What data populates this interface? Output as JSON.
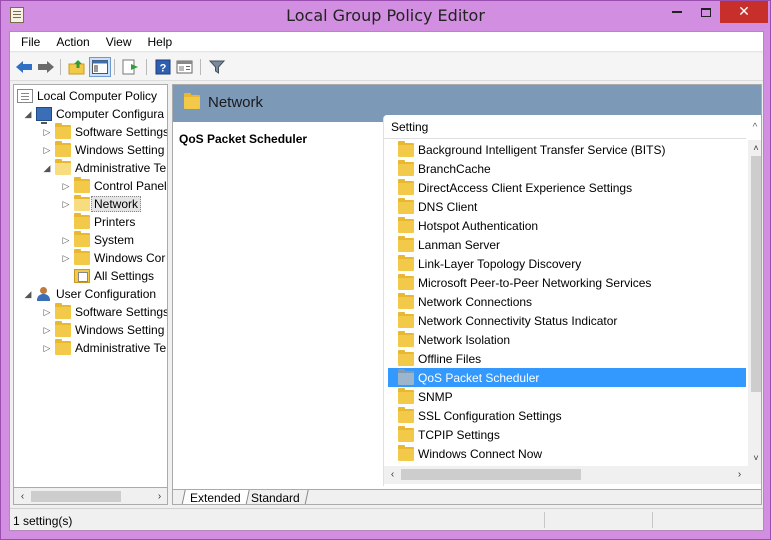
{
  "window": {
    "title": "Local Group Policy Editor",
    "close_glyph": "✕"
  },
  "menu": [
    "File",
    "Action",
    "View",
    "Help"
  ],
  "toolbar": {
    "buttons": [
      "back-icon",
      "forward-icon",
      "up-folder-icon",
      "show-hide-tree-icon",
      "export-list-icon",
      "help-icon",
      "properties-icon",
      "filter-icon"
    ]
  },
  "tree": {
    "items": [
      {
        "label": "Local Computer Policy",
        "expander": "",
        "icon": "doc-icon"
      },
      {
        "label": "Computer Configura",
        "expander": "◢",
        "icon": "computer-icon"
      },
      {
        "label": "Software Settings",
        "expander": "▷",
        "icon": "folder-icon"
      },
      {
        "label": "Windows Setting",
        "expander": "▷",
        "icon": "folder-icon"
      },
      {
        "label": "Administrative Te",
        "expander": "◢",
        "icon": "folder-icon"
      },
      {
        "label": "Control Panel",
        "expander": "▷",
        "icon": "folder-icon"
      },
      {
        "label": "Network",
        "expander": "▷",
        "icon": "folder-icon"
      },
      {
        "label": "Printers",
        "expander": "",
        "icon": "folder-icon"
      },
      {
        "label": "System",
        "expander": "▷",
        "icon": "folder-icon"
      },
      {
        "label": "Windows Cor",
        "expander": "▷",
        "icon": "folder-icon"
      },
      {
        "label": "All Settings",
        "expander": "",
        "icon": "all-settings-icon"
      },
      {
        "label": "User Configuration",
        "expander": "◢",
        "icon": "user-icon"
      },
      {
        "label": "Software Settings",
        "expander": "▷",
        "icon": "folder-icon"
      },
      {
        "label": "Windows Setting",
        "expander": "▷",
        "icon": "folder-icon"
      },
      {
        "label": "Administrative Te",
        "expander": "▷",
        "icon": "folder-icon"
      }
    ],
    "scroll_left": "‹",
    "scroll_right": "›"
  },
  "pane": {
    "header_title": "Network",
    "selected_title": "QoS Packet Scheduler",
    "column_header": "Setting",
    "sort_glyph": "^",
    "items": [
      "Background Intelligent Transfer Service (BITS)",
      "BranchCache",
      "DirectAccess Client Experience Settings",
      "DNS Client",
      "Hotspot Authentication",
      "Lanman Server",
      "Link-Layer Topology Discovery",
      "Microsoft Peer-to-Peer Networking Services",
      "Network Connections",
      "Network Connectivity Status Indicator",
      "Network Isolation",
      "Offline Files",
      "QoS Packet Scheduler",
      "SNMP",
      "SSL Configuration Settings",
      "TCPIP Settings",
      "Windows Connect Now"
    ],
    "selected_item": "QoS Packet Scheduler",
    "scroll_up": "˄",
    "scroll_down": "˅",
    "scroll_left": "‹",
    "scroll_right": "›"
  },
  "tabs": [
    "Extended",
    "Standard"
  ],
  "status": {
    "text": "1 setting(s)"
  },
  "colors": {
    "header_band": "#7c9ab8",
    "selection": "#3399ff",
    "folder": "#f3c94a",
    "close": "#c7302a"
  }
}
